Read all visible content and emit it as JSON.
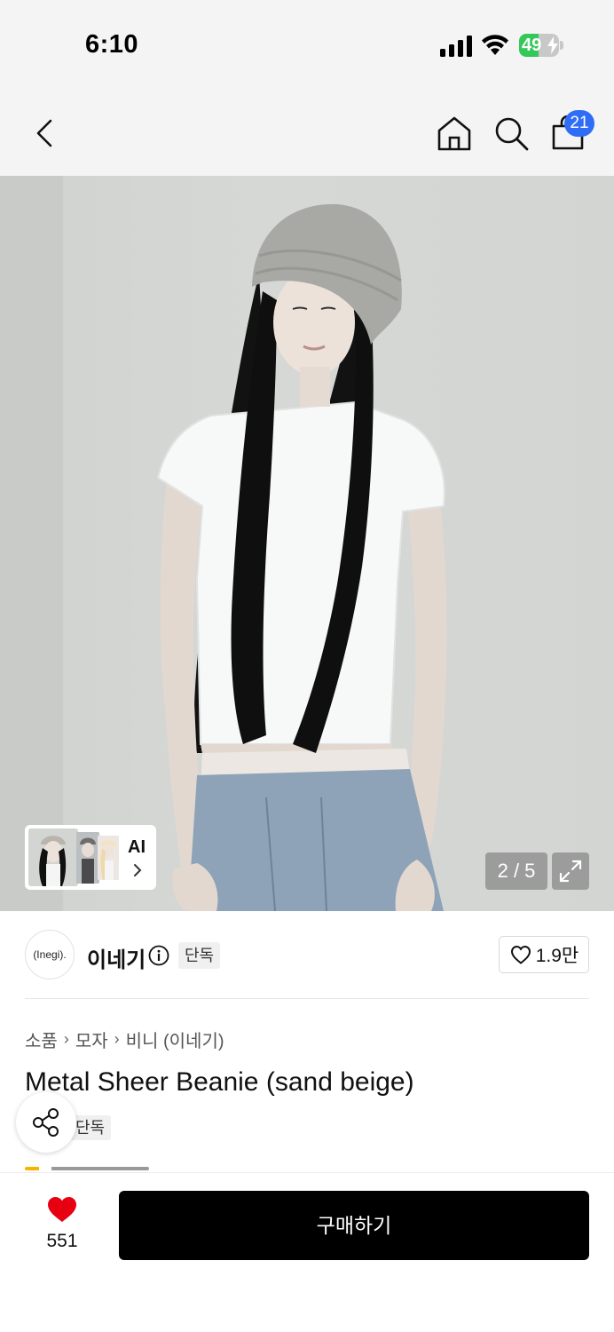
{
  "status_bar": {
    "time": "6:10",
    "battery": "49",
    "battery_level": 0.49
  },
  "nav": {
    "cart_count": "21",
    "icons": [
      "chevron-left-icon",
      "home-icon",
      "search-icon",
      "bag-icon"
    ]
  },
  "gallery": {
    "ai_label": "AI",
    "counter": "2 / 5"
  },
  "brand": {
    "logo_text": "(Inegi).",
    "name": "이네기",
    "exclusive": "단독",
    "likes": "1.9만"
  },
  "breadcrumb": [
    "소품",
    "모자",
    "비니 (이네기)"
  ],
  "product": {
    "title": "Metal Sheer Beanie (sand beige)",
    "exclusive": "단독"
  },
  "bottom_bar": {
    "wish_count": "551",
    "buy_label": "구매하기"
  },
  "colors": {
    "accent_badge": "#2f6df6",
    "heart": "#e60012",
    "buy_button": "#000000",
    "battery": "#34c759"
  }
}
